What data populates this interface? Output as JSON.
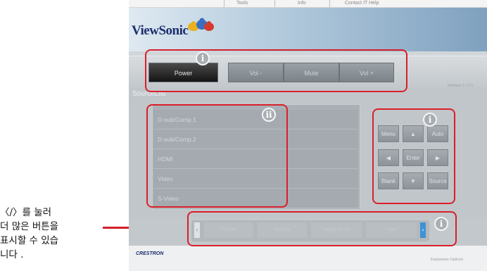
{
  "caption": {
    "line1": "〈/〉를 눌러",
    "line2": "더 많은 버튼을",
    "line3": "표시할 수 있습",
    "line4": "니다 ."
  },
  "topnav": {
    "tools": "Tools",
    "info": "Info",
    "contact": "Contact IT Help"
  },
  "header": {
    "brand": "ViewSonic"
  },
  "power_bar": {
    "power": "Power",
    "vol_down": "Vol -",
    "mute": "Mute",
    "vol_up": "Vol +"
  },
  "version": "Interface 2.7.2.5",
  "source": {
    "title": "SourceList",
    "items": [
      "D-sub/Comp.1",
      "D-sub/Comp.2",
      "HDMI",
      "Video",
      "S-Video"
    ]
  },
  "control": {
    "menu": "Menu",
    "up": "▲",
    "auto": "Auto",
    "left": "◀",
    "enter": "Enter",
    "right": "▶",
    "blank": "Blank",
    "down": "▼",
    "source": "Source"
  },
  "scroll_buttons": [
    "Freeze",
    "Volume",
    "Digital Zoom",
    "Input"
  ],
  "scroll_arrows": {
    "left": "‹",
    "right": "›"
  },
  "footer": {
    "crestron": "CRESTRON",
    "expansion": "Expansion Options"
  },
  "badges": {
    "i": "i",
    "ii": "ii"
  },
  "colors": {
    "annotation": "#d91f2a",
    "scroll_right_accent": "#3f92d4"
  }
}
